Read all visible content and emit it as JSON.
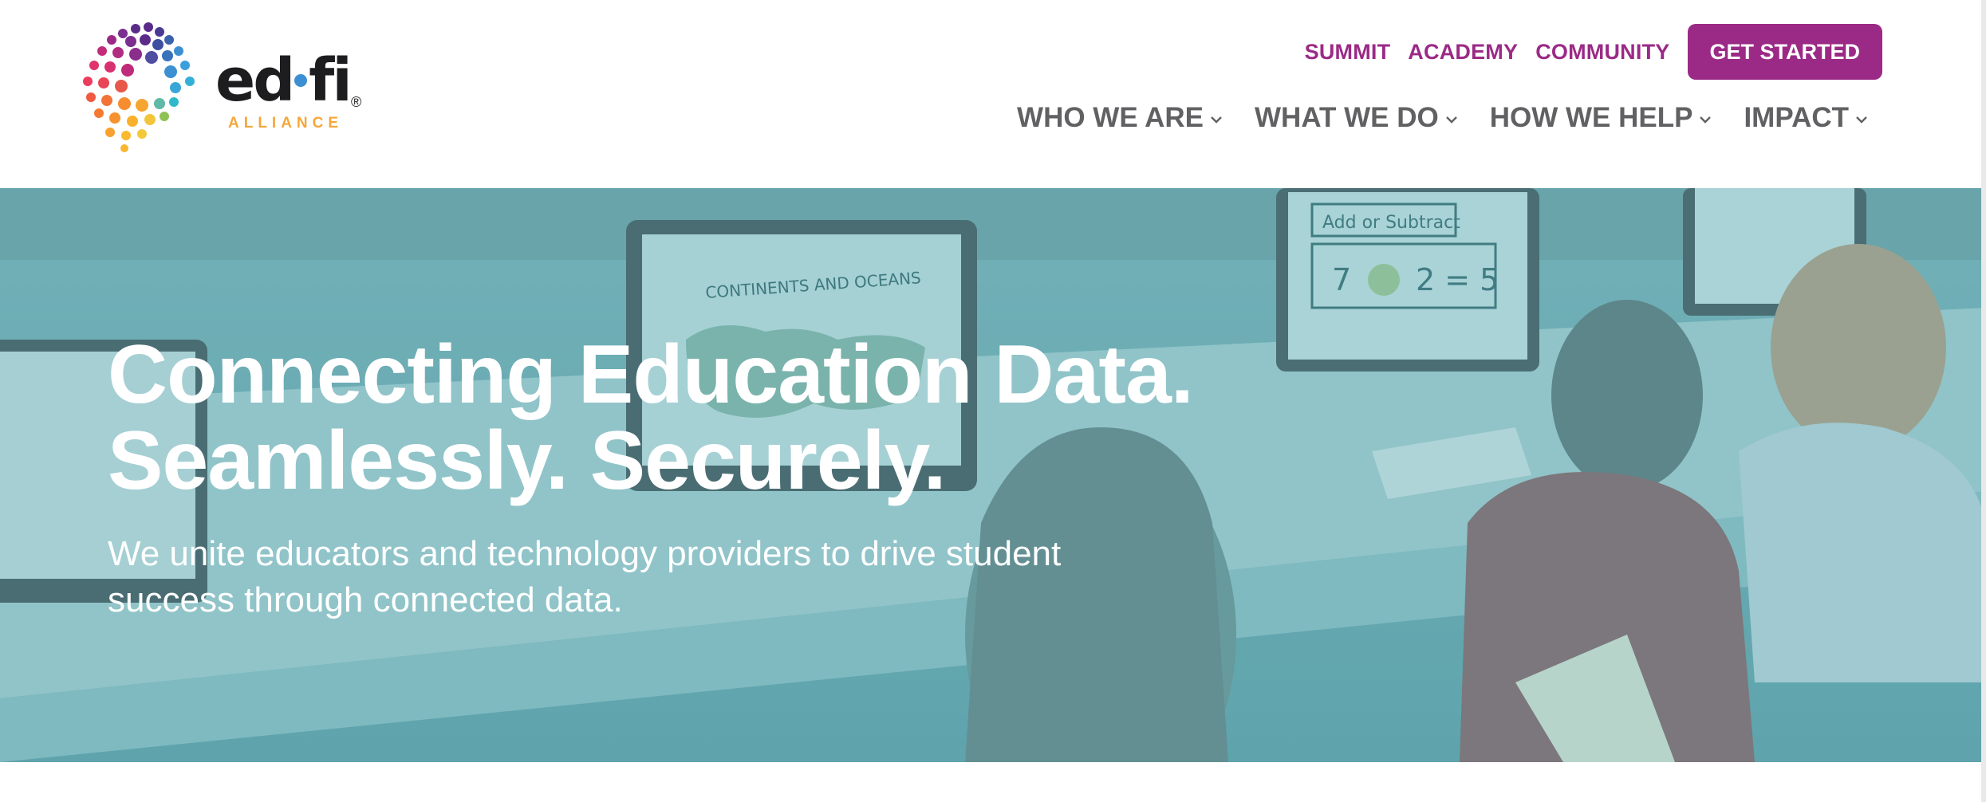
{
  "brand": {
    "logo_word": "ed-fi",
    "logo_word_left": "ed",
    "logo_word_right": "fi",
    "logo_sub": "ALLIANCE",
    "logo_reg": "®",
    "accent": "#9b2a86"
  },
  "utility_nav": {
    "links": [
      "SUMMIT",
      "ACADEMY",
      "COMMUNITY"
    ],
    "cta": "GET STARTED"
  },
  "main_nav": {
    "items": [
      "WHO WE ARE",
      "WHAT WE DO",
      "HOW WE HELP",
      "IMPACT"
    ],
    "item_icon": "chevron-down-icon"
  },
  "hero": {
    "title_line1": "Connecting Education Data.",
    "title_line2": "Seamlessly. Securely.",
    "subtitle": "We unite educators and technology providers to drive student success through connected data.",
    "image": "classroom-photo"
  }
}
